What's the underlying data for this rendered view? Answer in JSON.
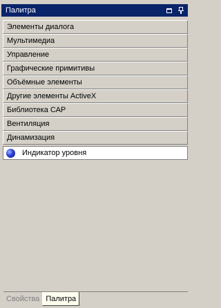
{
  "window": {
    "title": "Палитра"
  },
  "groups": [
    {
      "label": "Элементы диалога"
    },
    {
      "label": "Мультимедиа"
    },
    {
      "label": "Управление"
    },
    {
      "label": "Графические примитивы"
    },
    {
      "label": "Объёмные элементы"
    },
    {
      "label": "Другие элементы ActiveX"
    },
    {
      "label": "Библиотека САР"
    },
    {
      "label": "Вентиляция"
    },
    {
      "label": "Динамизация"
    }
  ],
  "items": [
    {
      "label": "Индикатор уровня",
      "icon": "blue-sphere-icon"
    }
  ],
  "tabs": [
    {
      "label": "Свойства",
      "active": false
    },
    {
      "label": "Палитра",
      "active": true
    }
  ],
  "colors": {
    "titlebar": "#0a246a",
    "panel": "#d4d0c8",
    "indicator": "#2a3fd6"
  }
}
